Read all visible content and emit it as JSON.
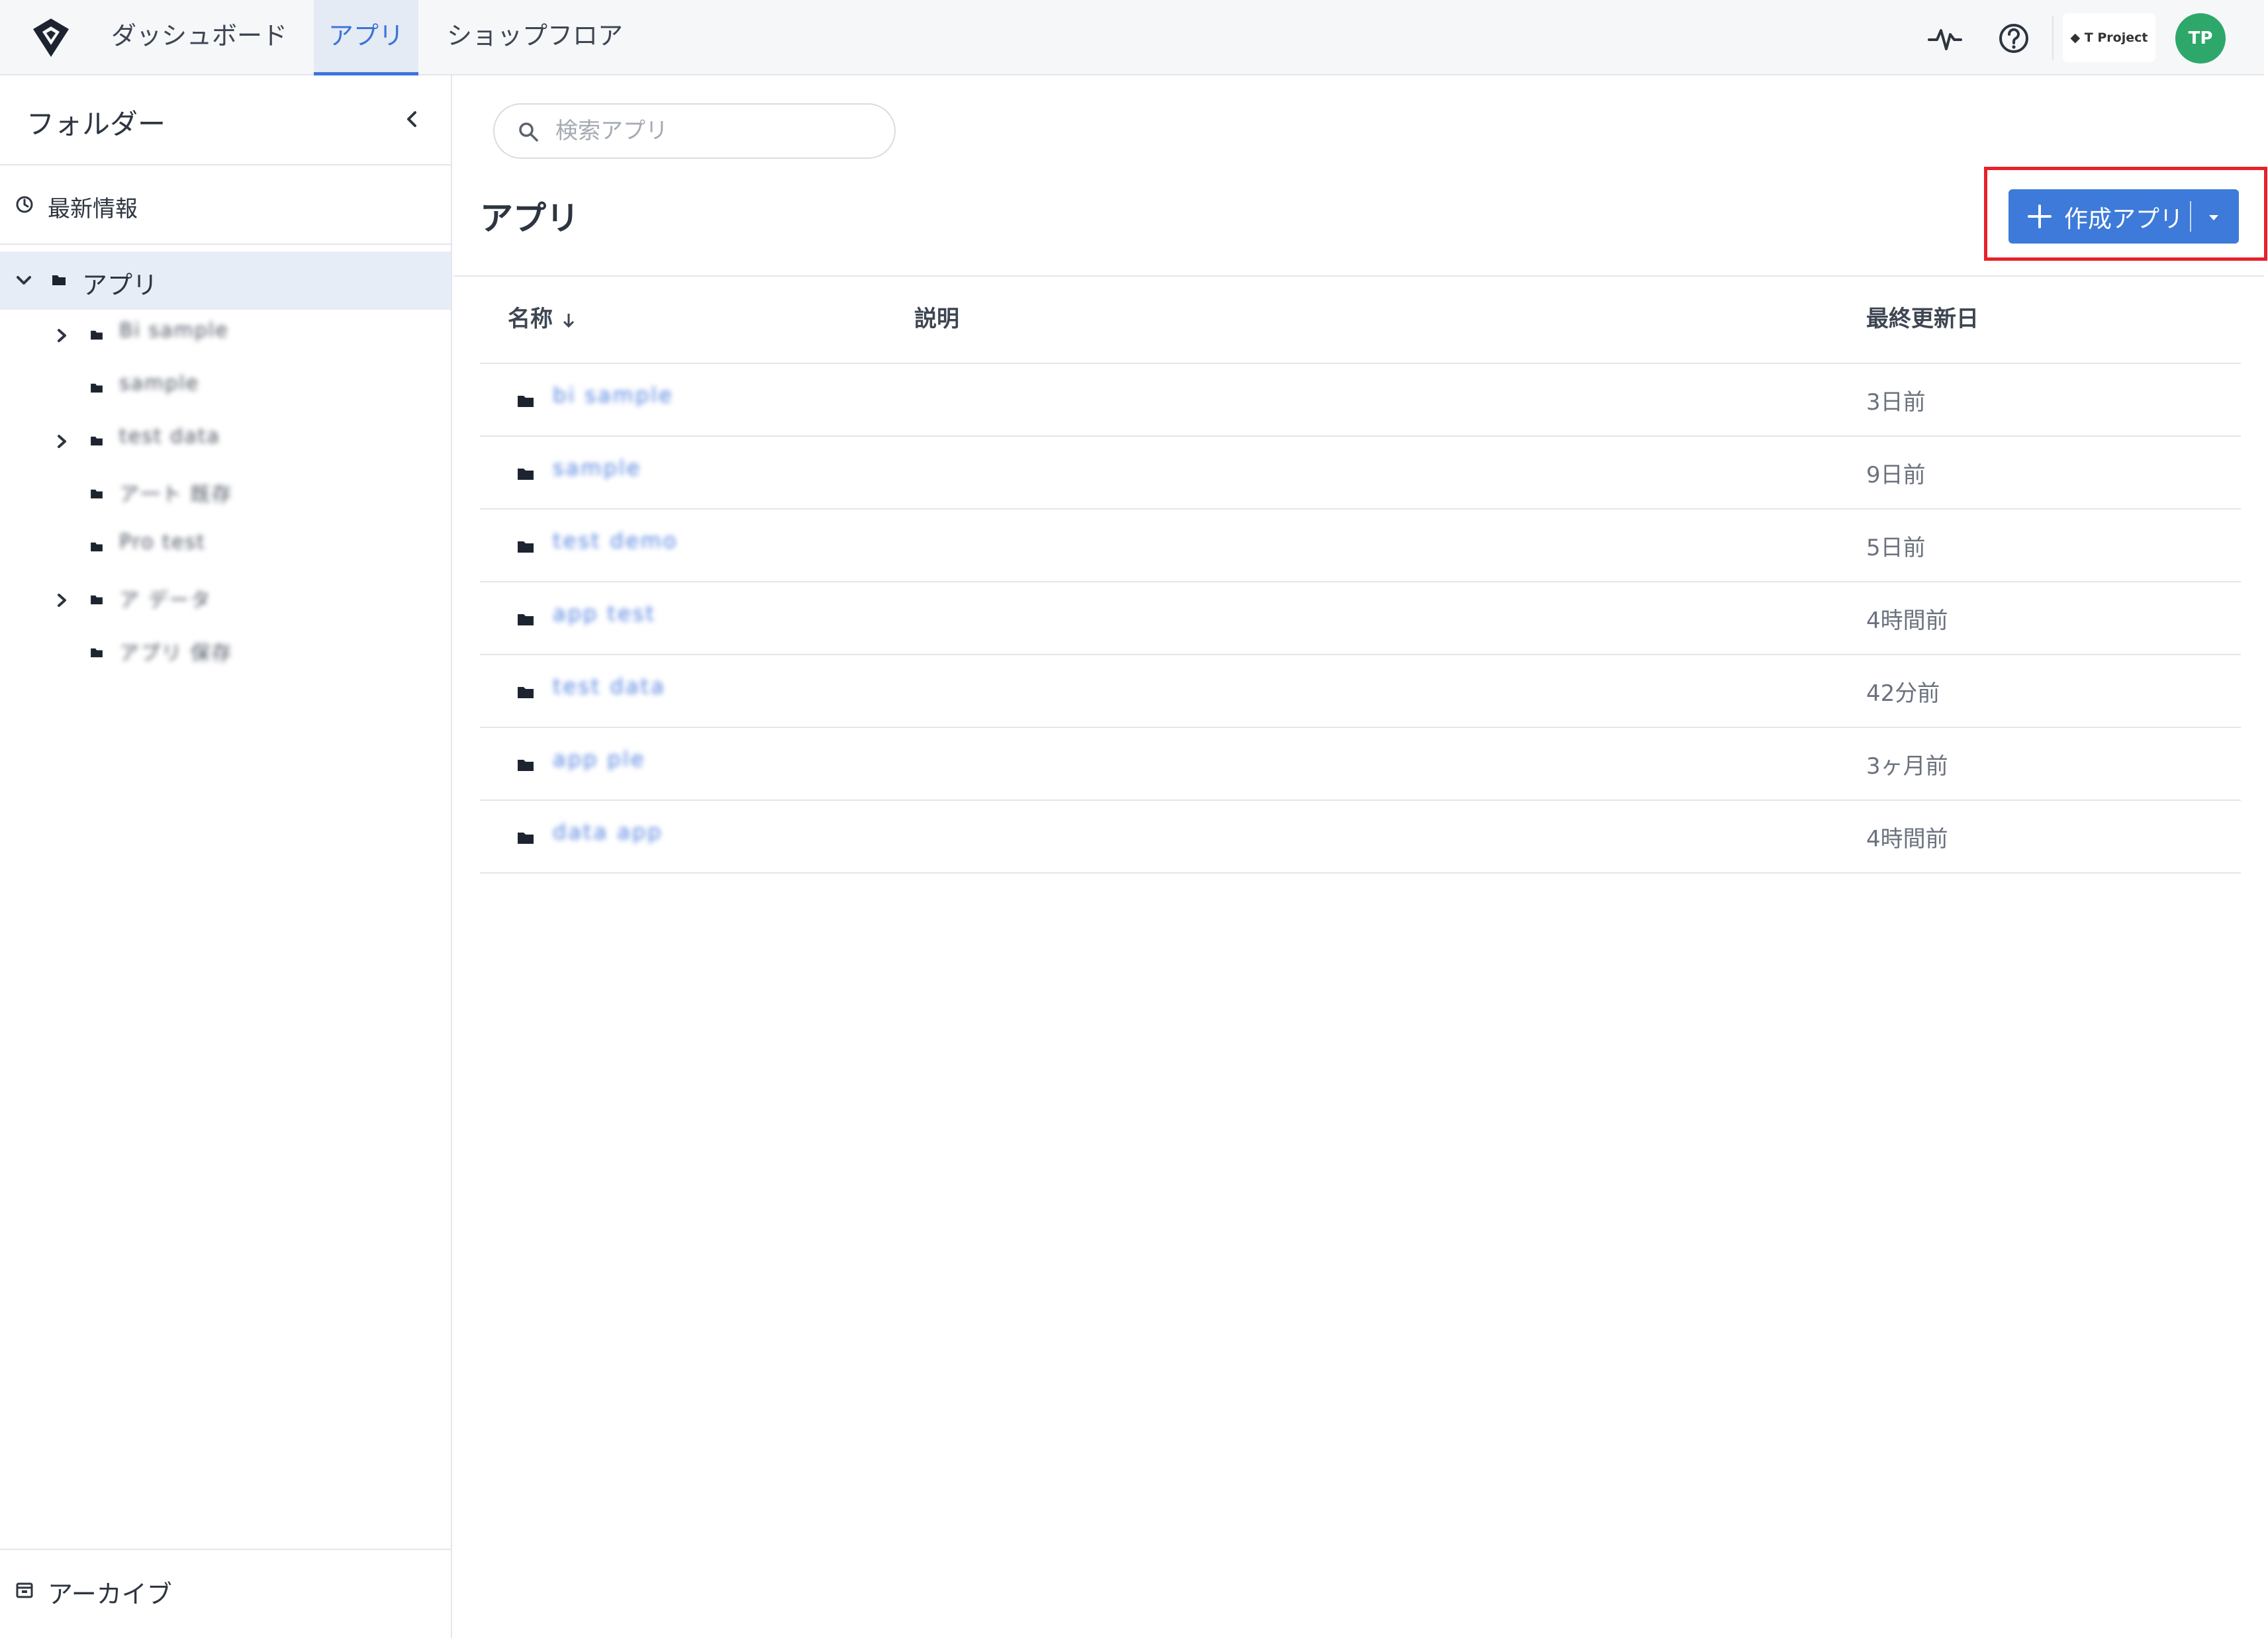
{
  "topnav": {
    "tabs": [
      {
        "label": "ダッシュボード",
        "active": false
      },
      {
        "label": "アプリ",
        "active": true
      },
      {
        "label": "ショップフロア",
        "active": false
      }
    ],
    "icons": [
      "activity-icon",
      "help-icon"
    ],
    "workspace_label": "T Project",
    "avatar_initials": "TP",
    "accent_color": "#3d74d9",
    "avatar_color": "#2ea86a"
  },
  "sidebar": {
    "title": "フォルダー",
    "recent_label": "最新情報",
    "root_label": "アプリ",
    "items": [
      {
        "label": "Bi sample",
        "expandable": true
      },
      {
        "label": "sample",
        "expandable": false
      },
      {
        "label": "test data",
        "expandable": true
      },
      {
        "label": "ア一ト 既存",
        "expandable": false
      },
      {
        "label": "Pro test",
        "expandable": false
      },
      {
        "label": "ア データ",
        "expandable": true
      },
      {
        "label": "アプリ 保存",
        "expandable": false
      }
    ],
    "archive_label": "アーカイブ"
  },
  "main": {
    "search_placeholder": "検索アプリ",
    "title": "アプリ",
    "create_button_label": "作成アプリ",
    "create_button_color": "#3d7ad9",
    "highlight_color": "#e8202a",
    "columns": {
      "name": "名称",
      "description": "説明",
      "updated": "最終更新日"
    },
    "rows": [
      {
        "name": "bi sample",
        "updated": "3日前"
      },
      {
        "name": "sample",
        "updated": "9日前"
      },
      {
        "name": "test demo",
        "updated": "5日前"
      },
      {
        "name": "app test",
        "updated": "4時間前"
      },
      {
        "name": "test data",
        "updated": "42分前"
      },
      {
        "name": "app ple",
        "updated": "3ヶ月前"
      },
      {
        "name": "data app",
        "updated": "4時間前"
      }
    ]
  }
}
